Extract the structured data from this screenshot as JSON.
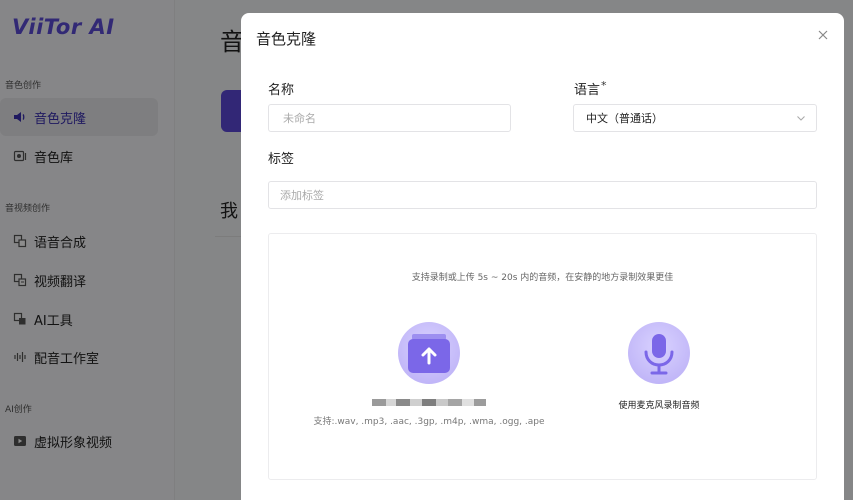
{
  "app": {
    "logo": "ViiTor AI"
  },
  "sidebar": {
    "sections": [
      {
        "label": "音色创作"
      },
      {
        "label": "音视频创作"
      },
      {
        "label": "AI创作"
      }
    ],
    "items": [
      {
        "label": "音色克隆",
        "icon": "speaker-icon",
        "active": true
      },
      {
        "label": "音色库",
        "icon": "voice-library-icon"
      },
      {
        "label": "语音合成",
        "icon": "tts-icon"
      },
      {
        "label": "视频翻译",
        "icon": "video-translate-icon"
      },
      {
        "label": "AI工具",
        "icon": "ai-tools-icon"
      },
      {
        "label": "配音工作室",
        "icon": "waveform-icon"
      },
      {
        "label": "虚拟形象视频",
        "icon": "play-icon"
      }
    ]
  },
  "background": {
    "title": "音",
    "subtitle": "我"
  },
  "modal": {
    "title": "音色克隆",
    "name_label": "名称",
    "name_placeholder": "未命名",
    "language_label": "语言",
    "language_required": "*",
    "language_value": "中文（普通话）",
    "tags_label": "标签",
    "tags_placeholder": "添加标签",
    "hint": "支持录制或上传 5s ~ 20s 内的音频，在安静的地方录制效果更佳",
    "upload_formats": "支持:.wav, .mp3, .aac, .3gp, .m4p, .wma, .ogg, .ape",
    "record_label": "使用麦克风录制音频"
  },
  "colors": {
    "accent": "#5b47d8",
    "accent_light": "#c4b9fa",
    "overlay": "rgba(0,0,0,0.45)"
  }
}
